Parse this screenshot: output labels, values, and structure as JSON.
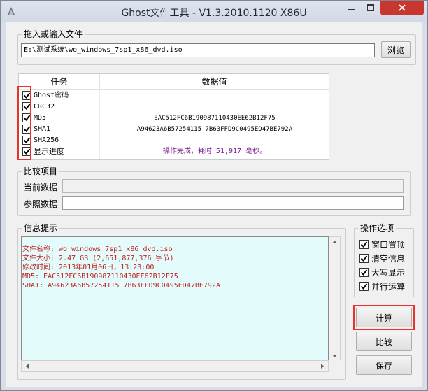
{
  "window": {
    "title": "Ghost文件工具 - V1.3.2010.1120 X86U"
  },
  "file_group": {
    "title": "拖入或输入文件",
    "path_value": "E:\\测试系统\\wo_windows_7sp1_x86_dvd.iso",
    "browse_label": "浏览"
  },
  "task_table": {
    "headers": [
      "任务",
      "数据值"
    ],
    "rows": [
      {
        "task": "Ghost密码",
        "value": "",
        "checked": true
      },
      {
        "task": "CRC32",
        "value": "",
        "checked": true
      },
      {
        "task": "MD5",
        "value": "EAC512FC6B190987110430EE62B12F75",
        "checked": true
      },
      {
        "task": "SHA1",
        "value": "A94623A6B57254115 7B63FFD9C0495ED47BE792A",
        "checked": true
      },
      {
        "task": "SHA256",
        "value": "",
        "checked": true
      },
      {
        "task": "显示进度",
        "value": "操作完成，耗时 51,917 毫秒。",
        "checked": true
      }
    ],
    "progress_color": "#7a1f8a"
  },
  "compare_group": {
    "title": "比较项目",
    "current_label": "当前数据",
    "reference_label": "参照数据",
    "current_value": "",
    "reference_value": ""
  },
  "info_group": {
    "title": "信息提示",
    "lines": [
      "文件名称: wo_windows_7sp1_x86_dvd.iso",
      "文件大小: 2.47 GB (2,651,877,376 字节)",
      "修改时间: 2013年01月06日，13:23:00",
      "MD5: EAC512FC6B190987110430EE62B12F75",
      "SHA1: A94623A6B57254115 7B63FFD9C0495ED47BE792A"
    ],
    "text_color": "#c21e1e",
    "background": "#e3fcfb"
  },
  "options_group": {
    "title": "操作选项",
    "items": [
      {
        "label": "窗口置顶",
        "checked": true
      },
      {
        "label": "清空信息",
        "checked": true
      },
      {
        "label": "大写显示",
        "checked": true
      },
      {
        "label": "并行运算",
        "checked": true
      }
    ]
  },
  "actions": {
    "compute_label": "计算",
    "compare_label": "比较",
    "save_label": "保存"
  },
  "highlight_color": "#e8322c"
}
